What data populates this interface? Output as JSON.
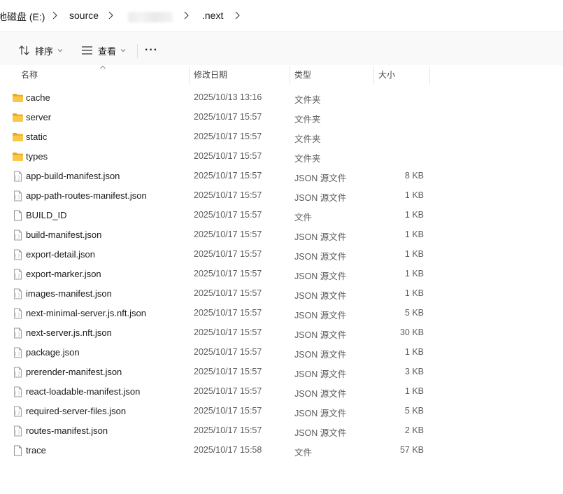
{
  "breadcrumb": {
    "items": [
      "地磁盘 (E:)",
      "source",
      ".next"
    ]
  },
  "toolbar": {
    "sort_label": "排序",
    "view_label": "查看",
    "more_label": "···"
  },
  "columns": {
    "name": "名称",
    "date": "修改日期",
    "type": "类型",
    "size": "大小"
  },
  "files": [
    {
      "name": "cache",
      "date": "2025/10/13 13:16",
      "type": "文件夹",
      "size": "",
      "kind": "folder"
    },
    {
      "name": "server",
      "date": "2025/10/17 15:57",
      "type": "文件夹",
      "size": "",
      "kind": "folder"
    },
    {
      "name": "static",
      "date": "2025/10/17 15:57",
      "type": "文件夹",
      "size": "",
      "kind": "folder"
    },
    {
      "name": "types",
      "date": "2025/10/17 15:57",
      "type": "文件夹",
      "size": "",
      "kind": "folder"
    },
    {
      "name": "app-build-manifest.json",
      "date": "2025/10/17 15:57",
      "type": "JSON 源文件",
      "size": "8 KB",
      "kind": "json"
    },
    {
      "name": "app-path-routes-manifest.json",
      "date": "2025/10/17 15:57",
      "type": "JSON 源文件",
      "size": "1 KB",
      "kind": "json"
    },
    {
      "name": "BUILD_ID",
      "date": "2025/10/17 15:57",
      "type": "文件",
      "size": "1 KB",
      "kind": "file"
    },
    {
      "name": "build-manifest.json",
      "date": "2025/10/17 15:57",
      "type": "JSON 源文件",
      "size": "1 KB",
      "kind": "json"
    },
    {
      "name": "export-detail.json",
      "date": "2025/10/17 15:57",
      "type": "JSON 源文件",
      "size": "1 KB",
      "kind": "json"
    },
    {
      "name": "export-marker.json",
      "date": "2025/10/17 15:57",
      "type": "JSON 源文件",
      "size": "1 KB",
      "kind": "json"
    },
    {
      "name": "images-manifest.json",
      "date": "2025/10/17 15:57",
      "type": "JSON 源文件",
      "size": "1 KB",
      "kind": "json"
    },
    {
      "name": "next-minimal-server.js.nft.json",
      "date": "2025/10/17 15:57",
      "type": "JSON 源文件",
      "size": "5 KB",
      "kind": "json"
    },
    {
      "name": "next-server.js.nft.json",
      "date": "2025/10/17 15:57",
      "type": "JSON 源文件",
      "size": "30 KB",
      "kind": "json"
    },
    {
      "name": "package.json",
      "date": "2025/10/17 15:57",
      "type": "JSON 源文件",
      "size": "1 KB",
      "kind": "json"
    },
    {
      "name": "prerender-manifest.json",
      "date": "2025/10/17 15:57",
      "type": "JSON 源文件",
      "size": "3 KB",
      "kind": "json"
    },
    {
      "name": "react-loadable-manifest.json",
      "date": "2025/10/17 15:57",
      "type": "JSON 源文件",
      "size": "1 KB",
      "kind": "json"
    },
    {
      "name": "required-server-files.json",
      "date": "2025/10/17 15:57",
      "type": "JSON 源文件",
      "size": "5 KB",
      "kind": "json"
    },
    {
      "name": "routes-manifest.json",
      "date": "2025/10/17 15:57",
      "type": "JSON 源文件",
      "size": "2 KB",
      "kind": "json"
    },
    {
      "name": "trace",
      "date": "2025/10/17 15:58",
      "type": "文件",
      "size": "57 KB",
      "kind": "file"
    }
  ],
  "colors": {
    "folder": "#f8c846",
    "folder_dark": "#e9a91f",
    "text": "#1a1a1a",
    "muted": "#5c5c5c"
  }
}
